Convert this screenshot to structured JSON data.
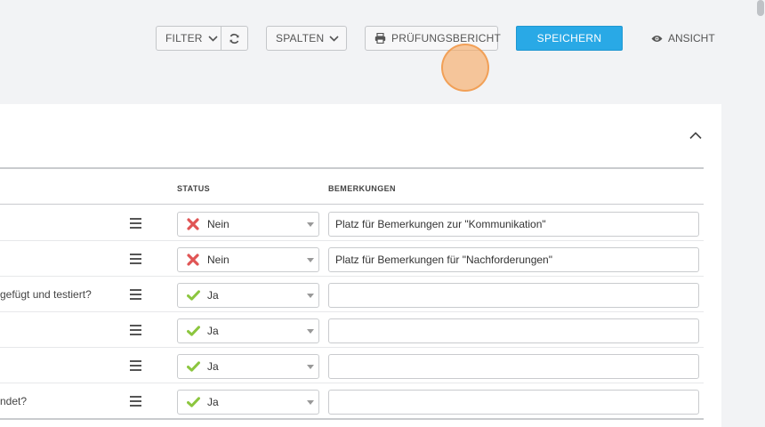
{
  "toolbar": {
    "filter_label": "FILTER",
    "spalten_label": "SPALTEN",
    "bericht_label": "PRÜFUNGSBERICHT",
    "save_label": "SPEICHERN",
    "ansicht_label": "ANSICHT"
  },
  "table": {
    "columns": {
      "status": "STATUS",
      "remarks": "BEMERKUNGEN"
    },
    "rows": [
      {
        "text": "",
        "status": "Nein",
        "status_icon": "cross-icon",
        "remark": "Platz für Bemerkungen zur  \"Kommunikation\""
      },
      {
        "text": "",
        "status": "Nein",
        "status_icon": "cross-icon",
        "remark": "Platz für Bemerkungen für \"Nachforderungen\""
      },
      {
        "text": "gefügt und testiert?",
        "status": "Ja",
        "status_icon": "check-icon",
        "remark": ""
      },
      {
        "text": "",
        "status": "Ja",
        "status_icon": "check-icon",
        "remark": ""
      },
      {
        "text": "",
        "status": "Ja",
        "status_icon": "check-icon",
        "remark": ""
      },
      {
        "text": "ndet?",
        "status": "Ja",
        "status_icon": "check-icon",
        "remark": ""
      }
    ]
  },
  "colors": {
    "accent": "#29a9e6",
    "no": "#e05555",
    "yes": "#8cc63f"
  }
}
